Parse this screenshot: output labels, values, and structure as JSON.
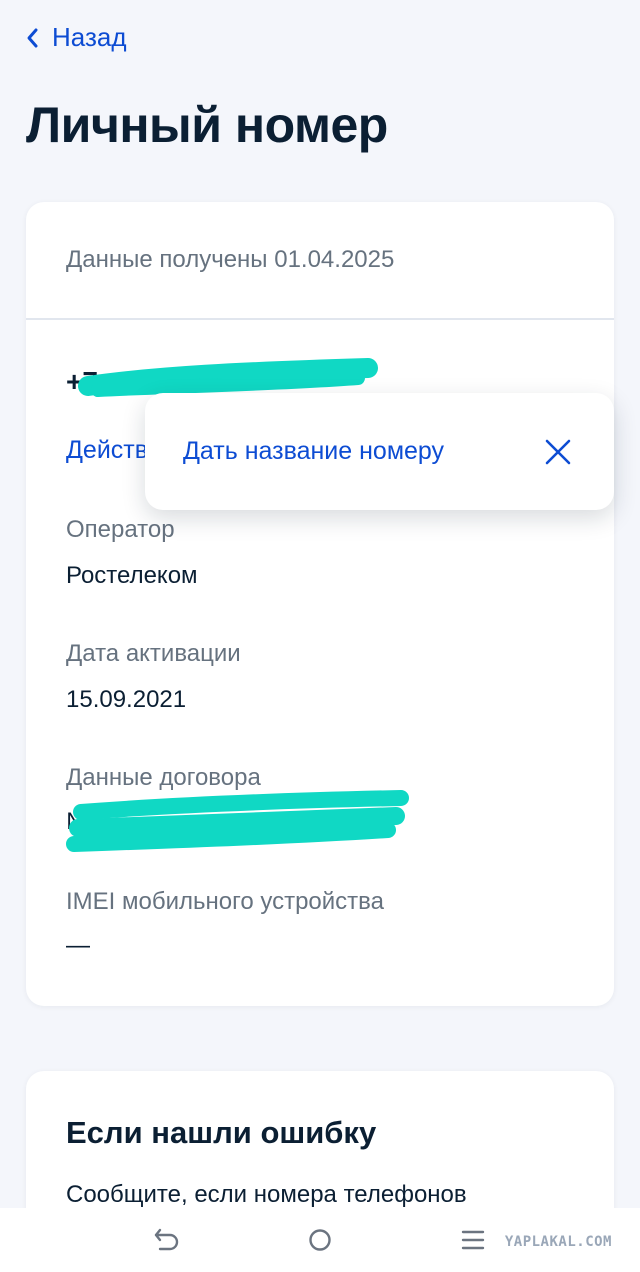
{
  "header": {
    "back_label": "Назад",
    "title": "Личный номер"
  },
  "card": {
    "received_text": "Данные получены 01.04.2025",
    "phone_prefix": "+7",
    "actions_label": "Действ",
    "fields": [
      {
        "label": "Оператор",
        "value": "Ростелеком"
      },
      {
        "label": "Дата активации",
        "value": "15.09.2021"
      },
      {
        "label": "Данные договора",
        "value": "№"
      },
      {
        "label": "IMEI мобильного устройства",
        "value": "—"
      }
    ]
  },
  "popover": {
    "item_label": "Дать название номеру"
  },
  "error_card": {
    "title": "Если нашли ошибку",
    "text": "Сообщите, если номера телефонов"
  },
  "watermark": "YAPLAKAL.COM",
  "colors": {
    "link": "#0d4cd3",
    "text": "#0b1f33",
    "muted": "#66727f",
    "scribble": "#10d8c4",
    "background": "#f4f6fb"
  },
  "icons": {
    "back": "chevron-left-icon",
    "close": "close-icon",
    "nav_back": "nav-back-icon",
    "nav_home": "nav-home-icon",
    "nav_menu": "nav-menu-icon"
  }
}
